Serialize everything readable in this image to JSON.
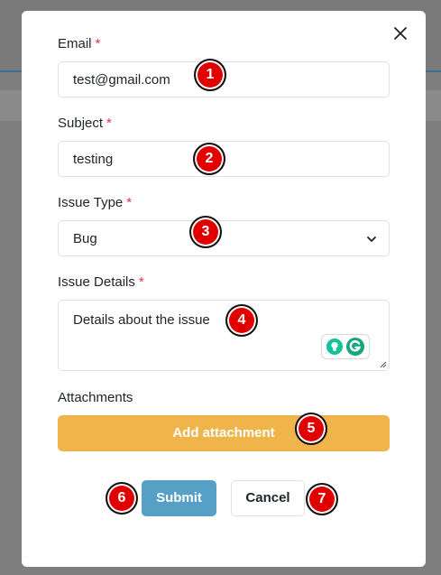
{
  "modal": {
    "close_icon": "close-icon",
    "required_mark": "*"
  },
  "form": {
    "email": {
      "label": "Email",
      "value": "test@gmail.com"
    },
    "subject": {
      "label": "Subject",
      "value": "testing"
    },
    "issue_type": {
      "label": "Issue Type",
      "selected": "Bug"
    },
    "issue_details": {
      "label": "Issue Details",
      "value": "Details about the issue"
    },
    "attachments": {
      "label": "Attachments",
      "button_label": "Add attachment"
    }
  },
  "actions": {
    "submit_label": "Submit",
    "cancel_label": "Cancel"
  },
  "markers": [
    "1",
    "2",
    "3",
    "4",
    "5",
    "6",
    "7"
  ],
  "colors": {
    "attach_button": "#efb54b",
    "submit_button": "#55a0c4",
    "required": "#dc3545",
    "marker": "#e00000"
  }
}
